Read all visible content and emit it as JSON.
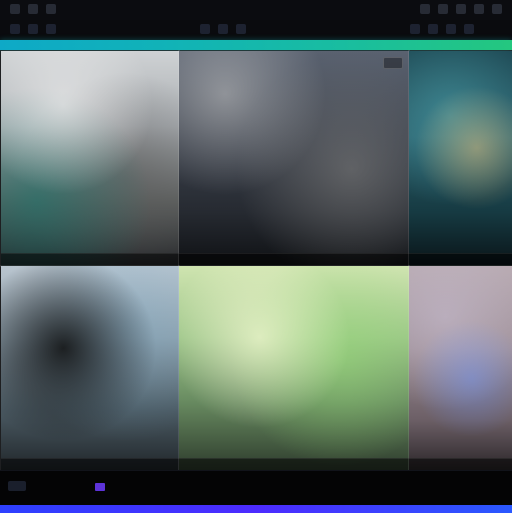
{
  "ui": {
    "top_texts": [
      "",
      "",
      "",
      "",
      ""
    ],
    "accent_text": "",
    "tiles": [
      {
        "label": ""
      },
      {
        "label": ""
      },
      {
        "label": ""
      },
      {
        "label": ""
      },
      {
        "label": ""
      },
      {
        "label": ""
      }
    ]
  },
  "colors": {
    "accent_cyan": "#12b7c6",
    "accent_blue": "#2d40ff"
  }
}
